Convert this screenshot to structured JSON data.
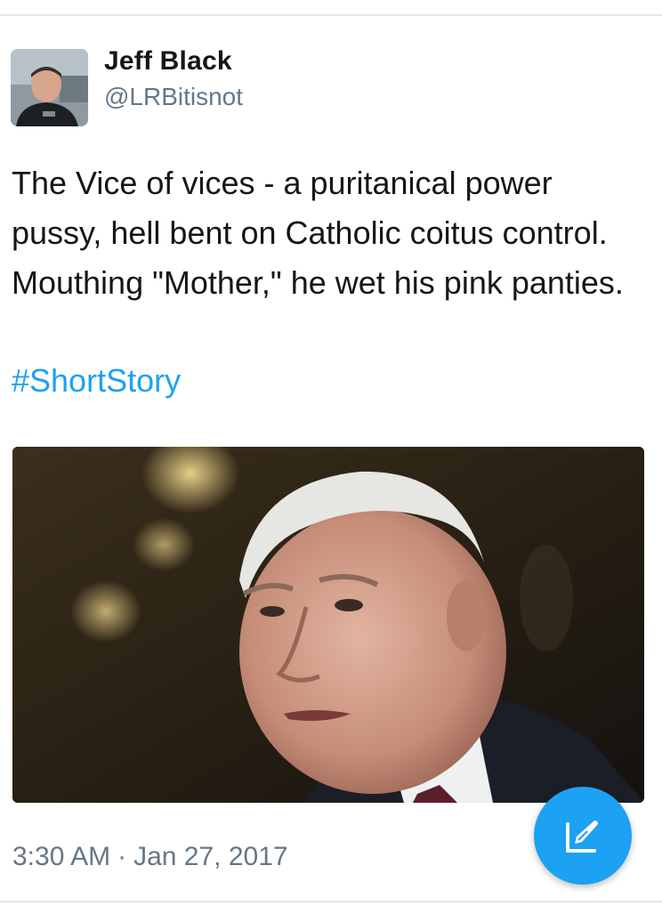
{
  "tweet": {
    "author": {
      "name": "Jeff Black",
      "handle": "@LRBitisnot"
    },
    "text": "The Vice of vices - a puritanical power pussy, hell bent on Catholic coitus control. Mouthing \"Mother,\" he wet his pink panties.",
    "hashtag": "#ShortStory",
    "time": "3:30 AM",
    "separator": "·",
    "date": "Jan 27, 2017"
  },
  "icons": {
    "compose": "compose-tweet-icon"
  },
  "colors": {
    "link": "#1da1f2",
    "secondary_text": "#657786",
    "primary_text": "#14171a",
    "fab": "#1da1f2"
  }
}
